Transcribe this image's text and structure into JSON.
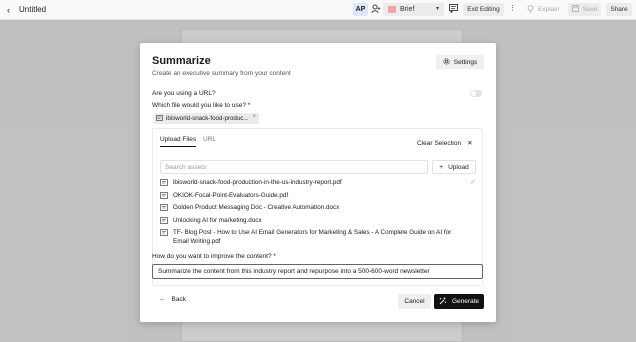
{
  "topbar": {
    "back_glyph": "‹",
    "doc_title": "Untitled",
    "ap_label": "AP",
    "tone_label": "Brief",
    "tone_color": "#f4a1a8",
    "exit_label": "Exit Editing",
    "explain_label": "Explain",
    "save_label": "Save",
    "share_label": "Share"
  },
  "modal": {
    "title": "Summarize",
    "subtitle": "Create an executive summary from your content",
    "settings_label": "Settings",
    "url_question": "Are you using a URL?",
    "url_toggle_on": false,
    "file_question": "Which file would you like to use? *",
    "selected_chip": "ibisworld-snack-food-produc...",
    "tabs": [
      {
        "label": "Upload Files",
        "active": true
      },
      {
        "label": "URL",
        "active": false
      }
    ],
    "clear_selection_label": "Clear Selection",
    "search_placeholder": "Search assets",
    "upload_label": "Upload",
    "files": [
      {
        "name": "ibisworld-snack-food-production-in-the-us-industry-report.pdf",
        "selected": true
      },
      {
        "name": "OKIOK-Focal-Point-Evaluators-Guide.pdf",
        "selected": false
      },
      {
        "name": "Golden Product Messaging Doc - Creative Automation.docx",
        "selected": false
      },
      {
        "name": "Unlocking AI for marketing.docx",
        "selected": false
      },
      {
        "name": "TF- Blog Post - How to Use AI Email Generators for Marketing & Sales - A Complete Guide on AI for Email Writing.pdf",
        "selected": false
      }
    ],
    "improve_question": "How do you want to improve the content? *",
    "prompt_value": "Summarize the content from this industry report and repurpose into a 500-600-word newsletter",
    "back_label": "Back",
    "cancel_label": "Cancel",
    "generate_label": "Generate"
  },
  "icons": {
    "back": "chevron-left-icon",
    "person": "person-add-icon",
    "comment": "comment-icon",
    "more": "more-vertical-icon",
    "explain": "lightbulb-icon",
    "save": "save-icon",
    "settings": "gear-icon",
    "file": "file-icon",
    "close": "close-icon",
    "plus": "plus-icon",
    "check": "check-icon",
    "arrow_left": "arrow-left-icon",
    "sparkle": "sparkle-icon"
  },
  "colors": {
    "accent": "#111111",
    "ap_bg": "#dbe6f8",
    "check": "#e08a96"
  }
}
